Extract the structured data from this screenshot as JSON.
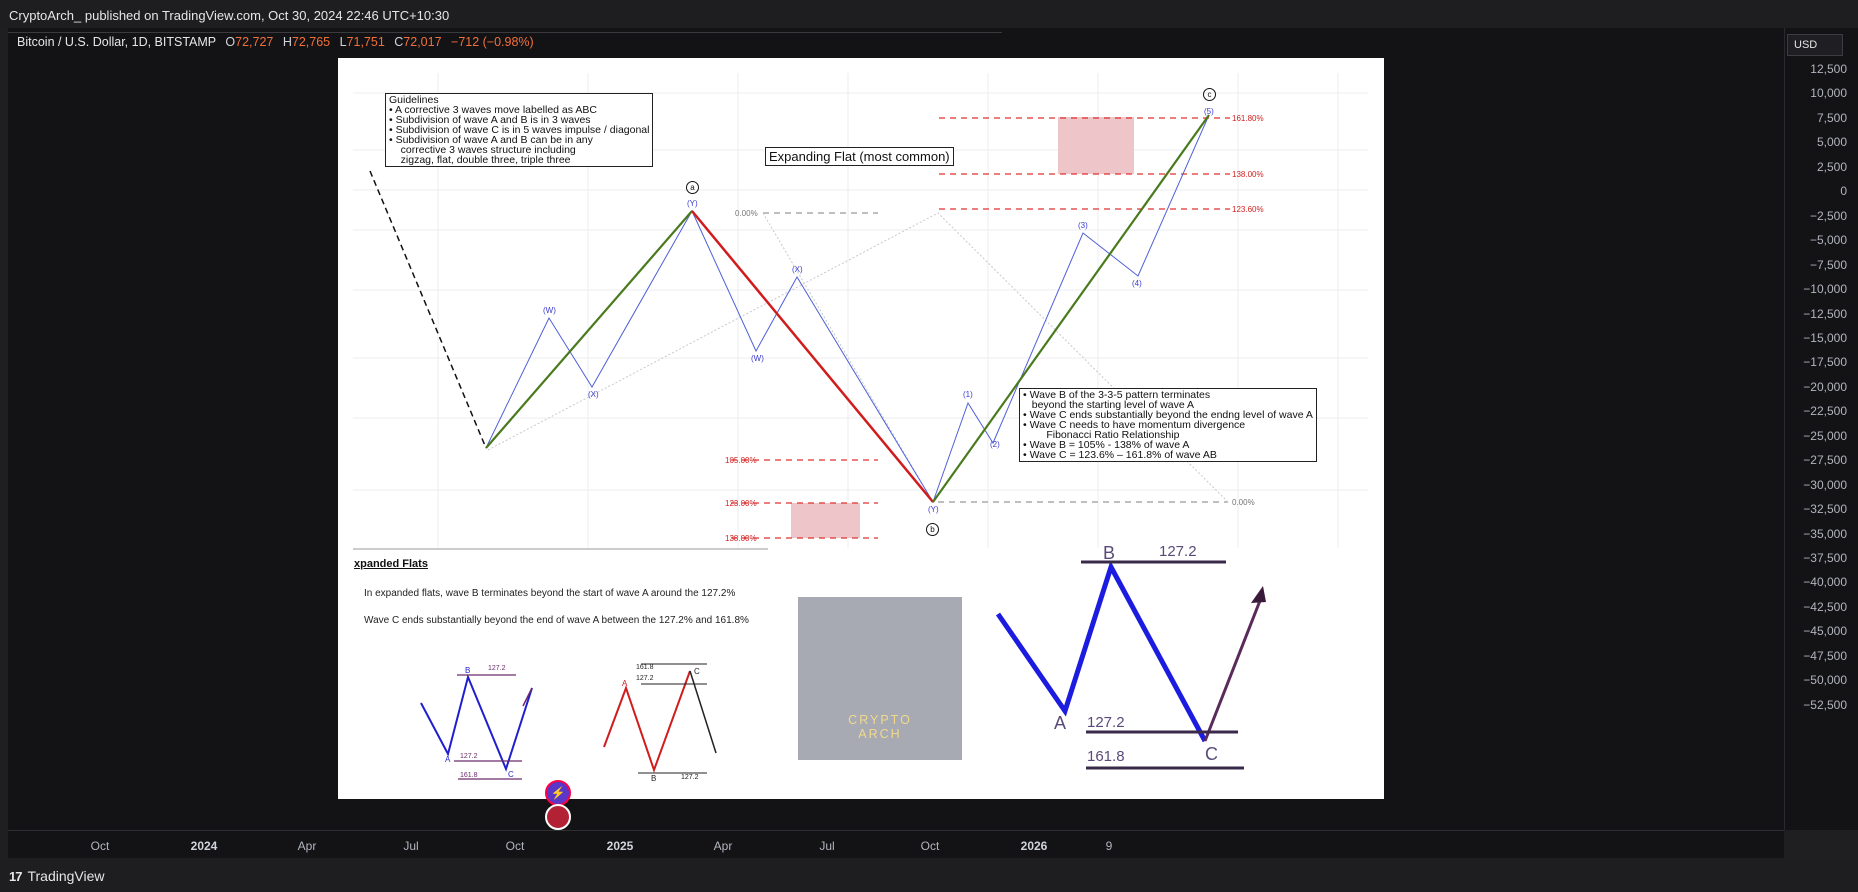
{
  "header": {
    "published_text": "CryptoArch_ published on TradingView.com, Oct 30, 2024 22:46 UTC+10:30"
  },
  "legend": {
    "symbol": "Bitcoin / U.S. Dollar, 1D, BITSTAMP",
    "open_label": "O",
    "open": "72,727",
    "high_label": "H",
    "high": "72,765",
    "low_label": "L",
    "low": "71,751",
    "close_label": "C",
    "close": "72,017",
    "change": "−712 (−0.98%)"
  },
  "price_axis": {
    "currency": "USD",
    "ticks": [
      "12,500",
      "10,000",
      "7,500",
      "5,000",
      "2,500",
      "0",
      "−2,500",
      "−5,000",
      "−7,500",
      "−10,000",
      "−12,500",
      "−15,000",
      "−17,500",
      "−20,000",
      "−22,500",
      "−25,000",
      "−27,500",
      "−30,000",
      "−32,500",
      "−35,000",
      "−37,500",
      "−40,000",
      "−42,500",
      "−45,000",
      "−47,500",
      "−50,000",
      "−52,500"
    ]
  },
  "time_axis": {
    "ticks": [
      {
        "label": "Oct",
        "year": false
      },
      {
        "label": "2024",
        "year": true
      },
      {
        "label": "Apr",
        "year": false
      },
      {
        "label": "Jul",
        "year": false
      },
      {
        "label": "Oct",
        "year": false
      },
      {
        "label": "2025",
        "year": true
      },
      {
        "label": "Apr",
        "year": false
      },
      {
        "label": "Jul",
        "year": false
      },
      {
        "label": "Oct",
        "year": false
      },
      {
        "label": "2026",
        "year": true
      },
      {
        "label": "9",
        "year": false
      }
    ]
  },
  "image": {
    "guidelines": "Guidelines\n• A corrective 3 waves move labelled as ABC\n• Subdivision of wave A and B is in 3 waves\n• Subdivision of wave C is in 5 waves impulse / diagonal\n• Subdivision of wave A and B can be in any\n    corrective 3 waves structure including\n    zigzag, flat, double three, triple three",
    "title": "Expanding Flat (most common)",
    "rules": "• Wave B of the 3-3-5 pattern terminates\n   beyond the starting level of wave A\n• Wave C ends substantially beyond the endng level of wave A\n• Wave C needs to have momentum divergence\n        Fibonacci Ratio Relationship\n• Wave B = 105% - 138% of wave A\n• Wave C = 123.6% – 161.8% of wave AB",
    "wave_labels": {
      "a": "a",
      "b": "b",
      "c": "c",
      "W1": "(W)",
      "X1": "(X)",
      "Y1": "(Y)",
      "X2": "(X)",
      "W2": "(W)",
      "Y2": "(Y)",
      "i1": "(1)",
      "i2": "(2)",
      "i3": "(3)",
      "i4": "(4)",
      "i5": "(5)"
    },
    "fib": {
      "zero_a": "0.00%",
      "f105": "105.00%",
      "f123": "123.00%",
      "f138": "138.00%",
      "f1618": "161.80%",
      "f138b": "138.00%",
      "f1236": "123.60%",
      "zero_b": "0.00%"
    },
    "expanded": {
      "heading": "xpanded Flats",
      "line1": "In expanded flats, wave B terminates beyond the start of wave A around the 127.2%",
      "line2": "Wave C ends substantially beyond the end of wave A   between the 127.2% and 161.8%"
    },
    "small1": {
      "B": "B",
      "A": "A",
      "C": "C",
      "r1": "127.2",
      "r2": "127.2",
      "r3": "161.8"
    },
    "small2": {
      "A": "A",
      "B": "B",
      "C": "C",
      "r1": "161.8",
      "r2": "127.2",
      "r3": "127.2"
    },
    "big": {
      "B": "B",
      "A": "A",
      "C": "C",
      "r1": "127.2",
      "r2": "127.2",
      "r3": "161.8"
    },
    "logo": {
      "line1": "CRYPTO",
      "line2": "ARCH"
    }
  },
  "footer": {
    "brand": "TradingView"
  },
  "colors": {
    "accent": "#f0703a",
    "wave_up": "#4a7a1e",
    "wave_down": "#d01c1c",
    "subwave": "#4f5fd8",
    "fib_red": "#e03030"
  }
}
